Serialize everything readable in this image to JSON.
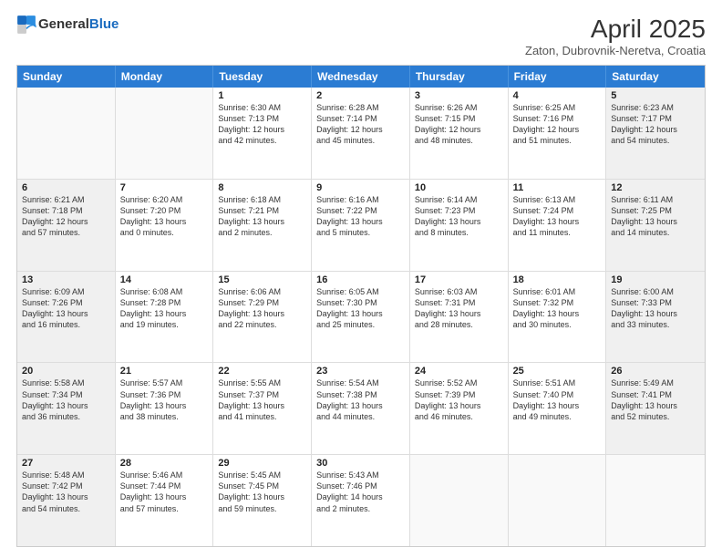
{
  "header": {
    "logo_general": "General",
    "logo_blue": "Blue",
    "title": "April 2025",
    "subtitle": "Zaton, Dubrovnik-Neretva, Croatia"
  },
  "days_of_week": [
    "Sunday",
    "Monday",
    "Tuesday",
    "Wednesday",
    "Thursday",
    "Friday",
    "Saturday"
  ],
  "weeks": [
    [
      {
        "num": "",
        "info": "",
        "empty": true
      },
      {
        "num": "",
        "info": "",
        "empty": true
      },
      {
        "num": "1",
        "info": "Sunrise: 6:30 AM\nSunset: 7:13 PM\nDaylight: 12 hours\nand 42 minutes."
      },
      {
        "num": "2",
        "info": "Sunrise: 6:28 AM\nSunset: 7:14 PM\nDaylight: 12 hours\nand 45 minutes."
      },
      {
        "num": "3",
        "info": "Sunrise: 6:26 AM\nSunset: 7:15 PM\nDaylight: 12 hours\nand 48 minutes."
      },
      {
        "num": "4",
        "info": "Sunrise: 6:25 AM\nSunset: 7:16 PM\nDaylight: 12 hours\nand 51 minutes."
      },
      {
        "num": "5",
        "info": "Sunrise: 6:23 AM\nSunset: 7:17 PM\nDaylight: 12 hours\nand 54 minutes.",
        "shaded": true
      }
    ],
    [
      {
        "num": "6",
        "info": "Sunrise: 6:21 AM\nSunset: 7:18 PM\nDaylight: 12 hours\nand 57 minutes.",
        "shaded": true
      },
      {
        "num": "7",
        "info": "Sunrise: 6:20 AM\nSunset: 7:20 PM\nDaylight: 13 hours\nand 0 minutes."
      },
      {
        "num": "8",
        "info": "Sunrise: 6:18 AM\nSunset: 7:21 PM\nDaylight: 13 hours\nand 2 minutes."
      },
      {
        "num": "9",
        "info": "Sunrise: 6:16 AM\nSunset: 7:22 PM\nDaylight: 13 hours\nand 5 minutes."
      },
      {
        "num": "10",
        "info": "Sunrise: 6:14 AM\nSunset: 7:23 PM\nDaylight: 13 hours\nand 8 minutes."
      },
      {
        "num": "11",
        "info": "Sunrise: 6:13 AM\nSunset: 7:24 PM\nDaylight: 13 hours\nand 11 minutes."
      },
      {
        "num": "12",
        "info": "Sunrise: 6:11 AM\nSunset: 7:25 PM\nDaylight: 13 hours\nand 14 minutes.",
        "shaded": true
      }
    ],
    [
      {
        "num": "13",
        "info": "Sunrise: 6:09 AM\nSunset: 7:26 PM\nDaylight: 13 hours\nand 16 minutes.",
        "shaded": true
      },
      {
        "num": "14",
        "info": "Sunrise: 6:08 AM\nSunset: 7:28 PM\nDaylight: 13 hours\nand 19 minutes."
      },
      {
        "num": "15",
        "info": "Sunrise: 6:06 AM\nSunset: 7:29 PM\nDaylight: 13 hours\nand 22 minutes."
      },
      {
        "num": "16",
        "info": "Sunrise: 6:05 AM\nSunset: 7:30 PM\nDaylight: 13 hours\nand 25 minutes."
      },
      {
        "num": "17",
        "info": "Sunrise: 6:03 AM\nSunset: 7:31 PM\nDaylight: 13 hours\nand 28 minutes."
      },
      {
        "num": "18",
        "info": "Sunrise: 6:01 AM\nSunset: 7:32 PM\nDaylight: 13 hours\nand 30 minutes."
      },
      {
        "num": "19",
        "info": "Sunrise: 6:00 AM\nSunset: 7:33 PM\nDaylight: 13 hours\nand 33 minutes.",
        "shaded": true
      }
    ],
    [
      {
        "num": "20",
        "info": "Sunrise: 5:58 AM\nSunset: 7:34 PM\nDaylight: 13 hours\nand 36 minutes.",
        "shaded": true
      },
      {
        "num": "21",
        "info": "Sunrise: 5:57 AM\nSunset: 7:36 PM\nDaylight: 13 hours\nand 38 minutes."
      },
      {
        "num": "22",
        "info": "Sunrise: 5:55 AM\nSunset: 7:37 PM\nDaylight: 13 hours\nand 41 minutes."
      },
      {
        "num": "23",
        "info": "Sunrise: 5:54 AM\nSunset: 7:38 PM\nDaylight: 13 hours\nand 44 minutes."
      },
      {
        "num": "24",
        "info": "Sunrise: 5:52 AM\nSunset: 7:39 PM\nDaylight: 13 hours\nand 46 minutes."
      },
      {
        "num": "25",
        "info": "Sunrise: 5:51 AM\nSunset: 7:40 PM\nDaylight: 13 hours\nand 49 minutes."
      },
      {
        "num": "26",
        "info": "Sunrise: 5:49 AM\nSunset: 7:41 PM\nDaylight: 13 hours\nand 52 minutes.",
        "shaded": true
      }
    ],
    [
      {
        "num": "27",
        "info": "Sunrise: 5:48 AM\nSunset: 7:42 PM\nDaylight: 13 hours\nand 54 minutes.",
        "shaded": true
      },
      {
        "num": "28",
        "info": "Sunrise: 5:46 AM\nSunset: 7:44 PM\nDaylight: 13 hours\nand 57 minutes."
      },
      {
        "num": "29",
        "info": "Sunrise: 5:45 AM\nSunset: 7:45 PM\nDaylight: 13 hours\nand 59 minutes."
      },
      {
        "num": "30",
        "info": "Sunrise: 5:43 AM\nSunset: 7:46 PM\nDaylight: 14 hours\nand 2 minutes."
      },
      {
        "num": "",
        "info": "",
        "empty": true
      },
      {
        "num": "",
        "info": "",
        "empty": true
      },
      {
        "num": "",
        "info": "",
        "empty": true,
        "shaded": true
      }
    ]
  ]
}
